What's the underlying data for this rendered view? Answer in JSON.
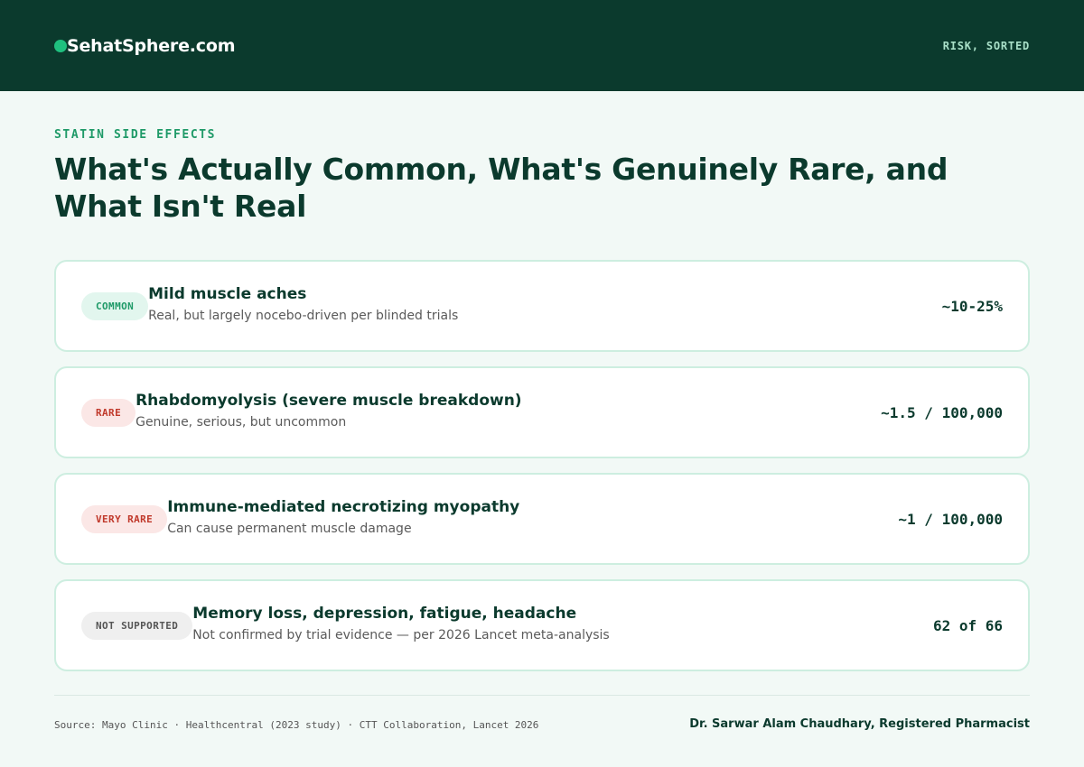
{
  "header": {
    "brand": "SehatSphere.com",
    "tagline": "RISK, SORTED"
  },
  "eyebrow": "STATIN SIDE EFFECTS",
  "title": "What's Actually Common, What's Genuinely Rare, and What Isn't Real",
  "cards": [
    {
      "badge": "COMMON",
      "title": "Mild muscle aches",
      "subtitle": "Real, but largely nocebo-driven per blinded trials",
      "stat": "~10-25%"
    },
    {
      "badge": "RARE",
      "title": "Rhabdomyolysis (severe muscle breakdown)",
      "subtitle": "Genuine, serious, but uncommon",
      "stat": "~1.5 / 100,000"
    },
    {
      "badge": "VERY RARE",
      "title": "Immune-mediated necrotizing myopathy",
      "subtitle": "Can cause permanent muscle damage",
      "stat": "~1 / 100,000"
    },
    {
      "badge": "NOT SUPPORTED",
      "title": "Memory loss, depression, fatigue, headache",
      "subtitle": "Not confirmed by trial evidence — per 2026 Lancet meta-analysis",
      "stat": "62 of 66"
    }
  ],
  "footer": {
    "source": "Source: Mayo Clinic · Healthcentral (2023 study) · CTT Collaboration, Lancet 2026",
    "author": "Dr. Sarwar Alam Chaudhary, Registered Pharmacist"
  },
  "colors": {
    "header_bg": "#0b3a2d",
    "accent": "#1fc07f",
    "common": "#1f9a68",
    "rare": "#c0392b",
    "neutral": "#555555"
  }
}
